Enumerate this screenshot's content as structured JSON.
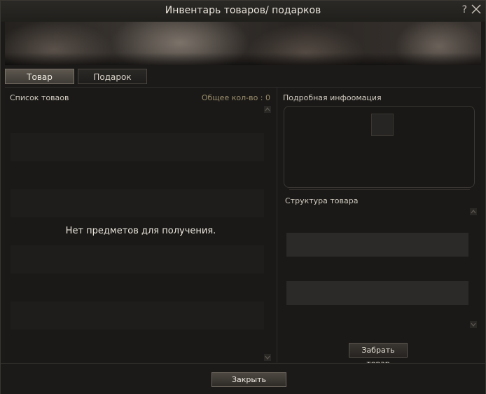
{
  "window": {
    "title": "Инвентарь товаров/ подарков",
    "help_label": "?"
  },
  "tabs": [
    {
      "label": "Товар",
      "active": true
    },
    {
      "label": "Подарок",
      "active": false
    }
  ],
  "left_panel": {
    "title": "Список товаов",
    "count_label": "Общее кол-во : 0",
    "empty_message": "Нет предметов для получения."
  },
  "right_panel": {
    "info_title": "Подробная инфоомация",
    "structure_title": "Структура товара",
    "take_button": "Забрать товар"
  },
  "footer": {
    "close_button": "Закрыть"
  },
  "colors": {
    "background": "#1b1a18",
    "accent_count": "#9d8f6d"
  }
}
